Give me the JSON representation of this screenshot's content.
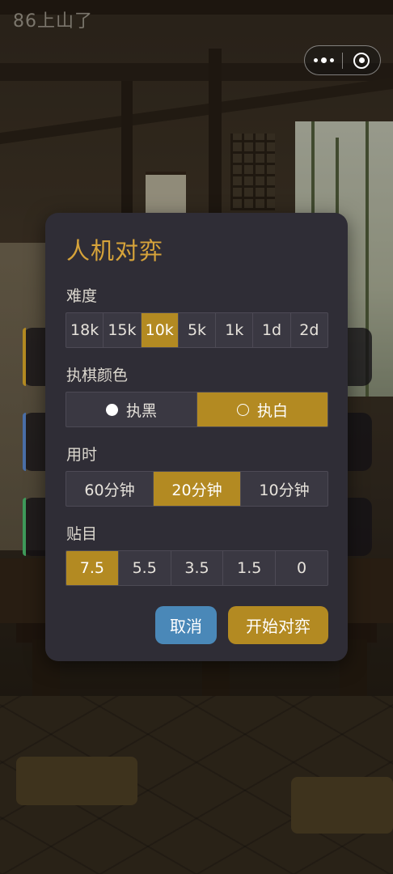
{
  "app": {
    "title": "86上山了"
  },
  "capsule": {
    "more_icon": "more-dots-icon",
    "close_icon": "target-close-icon"
  },
  "modal": {
    "title": "人机对弈",
    "difficulty": {
      "label": "难度",
      "options": [
        "18k",
        "15k",
        "10k",
        "5k",
        "1k",
        "1d",
        "2d"
      ],
      "selected": "10k"
    },
    "color": {
      "label": "执棋颜色",
      "options": [
        {
          "label": "执黑",
          "icon": "black-stone-icon"
        },
        {
          "label": "执白",
          "icon": "white-stone-icon"
        }
      ],
      "selected": "执白"
    },
    "time": {
      "label": "用时",
      "options": [
        "60分钟",
        "20分钟",
        "10分钟"
      ],
      "selected": "20分钟"
    },
    "komi": {
      "label": "贴目",
      "options": [
        "7.5",
        "5.5",
        "3.5",
        "1.5",
        "0"
      ],
      "selected": "7.5"
    },
    "buttons": {
      "cancel": "取消",
      "start": "开始对弈"
    }
  },
  "colors": {
    "accent": "#b38a22",
    "title": "#d6a33a",
    "cancel": "#4a88b8",
    "modal_bg": "#2f2d36"
  }
}
